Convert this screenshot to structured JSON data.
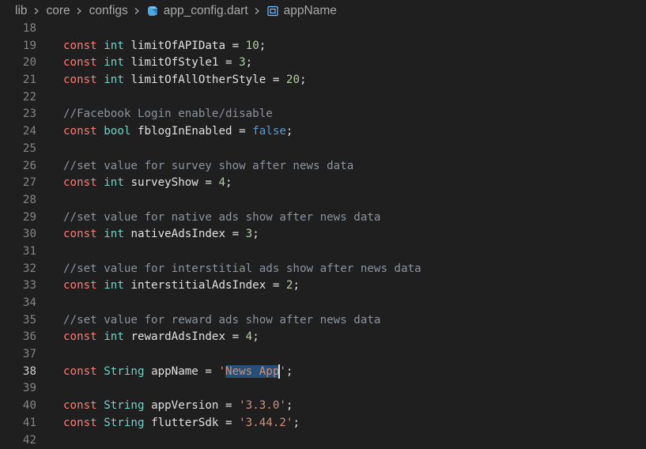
{
  "breadcrumb": {
    "items": [
      "lib",
      "core",
      "configs",
      "app_config.dart",
      "appName"
    ],
    "file_icon": "dart-file-icon",
    "symbol_icon": "field-symbol-icon"
  },
  "colors": {
    "background": "#1f1f1f",
    "keyword": "#ff7b72",
    "type": "#6fd3c8",
    "number": "#b5cea8",
    "boolean": "#569cd6",
    "string": "#ce9178",
    "comment": "#8b949e",
    "selection": "#264f78"
  },
  "editor": {
    "active_line": "38",
    "lines": [
      {
        "n": "18",
        "t": []
      },
      {
        "n": "19",
        "t": [
          [
            "kw",
            "const"
          ],
          [
            "sp",
            " "
          ],
          [
            "tp",
            "int"
          ],
          [
            "sp",
            " "
          ],
          [
            "id",
            "limitOfAPIData"
          ],
          [
            "id",
            " = "
          ],
          [
            "num",
            "10"
          ],
          [
            "id",
            ";"
          ]
        ]
      },
      {
        "n": "20",
        "t": [
          [
            "kw",
            "const"
          ],
          [
            "sp",
            " "
          ],
          [
            "tp",
            "int"
          ],
          [
            "sp",
            " "
          ],
          [
            "id",
            "limitOfStyle1"
          ],
          [
            "id",
            " = "
          ],
          [
            "num",
            "3"
          ],
          [
            "id",
            ";"
          ]
        ]
      },
      {
        "n": "21",
        "t": [
          [
            "kw",
            "const"
          ],
          [
            "sp",
            " "
          ],
          [
            "tp",
            "int"
          ],
          [
            "sp",
            " "
          ],
          [
            "id",
            "limitOfAllOtherStyle"
          ],
          [
            "id",
            " = "
          ],
          [
            "num",
            "20"
          ],
          [
            "id",
            ";"
          ]
        ]
      },
      {
        "n": "22",
        "t": []
      },
      {
        "n": "23",
        "t": [
          [
            "cm",
            "//Facebook Login enable/disable"
          ]
        ]
      },
      {
        "n": "24",
        "t": [
          [
            "kw",
            "const"
          ],
          [
            "sp",
            " "
          ],
          [
            "tp",
            "bool"
          ],
          [
            "sp",
            " "
          ],
          [
            "id",
            "fblogInEnabled"
          ],
          [
            "id",
            " = "
          ],
          [
            "bool",
            "false"
          ],
          [
            "id",
            ";"
          ]
        ]
      },
      {
        "n": "25",
        "t": []
      },
      {
        "n": "26",
        "t": [
          [
            "cm",
            "//set value for survey show after news data"
          ]
        ]
      },
      {
        "n": "27",
        "t": [
          [
            "kw",
            "const"
          ],
          [
            "sp",
            " "
          ],
          [
            "tp",
            "int"
          ],
          [
            "sp",
            " "
          ],
          [
            "id",
            "surveyShow"
          ],
          [
            "id",
            " = "
          ],
          [
            "num",
            "4"
          ],
          [
            "id",
            ";"
          ]
        ]
      },
      {
        "n": "28",
        "t": []
      },
      {
        "n": "29",
        "t": [
          [
            "cm",
            "//set value for native ads show after news data"
          ]
        ]
      },
      {
        "n": "30",
        "t": [
          [
            "kw",
            "const"
          ],
          [
            "sp",
            " "
          ],
          [
            "tp",
            "int"
          ],
          [
            "sp",
            " "
          ],
          [
            "id",
            "nativeAdsIndex"
          ],
          [
            "id",
            " = "
          ],
          [
            "num",
            "3"
          ],
          [
            "id",
            ";"
          ]
        ]
      },
      {
        "n": "31",
        "t": []
      },
      {
        "n": "32",
        "t": [
          [
            "cm",
            "//set value for interstitial ads show after news data"
          ]
        ]
      },
      {
        "n": "33",
        "t": [
          [
            "kw",
            "const"
          ],
          [
            "sp",
            " "
          ],
          [
            "tp",
            "int"
          ],
          [
            "sp",
            " "
          ],
          [
            "id",
            "interstitialAdsIndex"
          ],
          [
            "id",
            " = "
          ],
          [
            "num",
            "2"
          ],
          [
            "id",
            ";"
          ]
        ]
      },
      {
        "n": "34",
        "t": []
      },
      {
        "n": "35",
        "t": [
          [
            "cm",
            "//set value for reward ads show after news data"
          ]
        ]
      },
      {
        "n": "36",
        "t": [
          [
            "kw",
            "const"
          ],
          [
            "sp",
            " "
          ],
          [
            "tp",
            "int"
          ],
          [
            "sp",
            " "
          ],
          [
            "id",
            "rewardAdsIndex"
          ],
          [
            "id",
            " = "
          ],
          [
            "num",
            "4"
          ],
          [
            "id",
            ";"
          ]
        ]
      },
      {
        "n": "37",
        "t": []
      },
      {
        "n": "38",
        "t": [
          [
            "kw",
            "const"
          ],
          [
            "sp",
            " "
          ],
          [
            "tp",
            "String"
          ],
          [
            "sp",
            " "
          ],
          [
            "id",
            "appName"
          ],
          [
            "id",
            " = "
          ],
          [
            "str",
            "'"
          ],
          [
            "sel",
            "News App"
          ],
          [
            "cur",
            ""
          ],
          [
            "str",
            "'"
          ],
          [
            "id",
            ";"
          ]
        ]
      },
      {
        "n": "39",
        "t": []
      },
      {
        "n": "40",
        "t": [
          [
            "kw",
            "const"
          ],
          [
            "sp",
            " "
          ],
          [
            "tp",
            "String"
          ],
          [
            "sp",
            " "
          ],
          [
            "id",
            "appVersion"
          ],
          [
            "id",
            " = "
          ],
          [
            "str",
            "'3.3.0'"
          ],
          [
            "id",
            ";"
          ]
        ]
      },
      {
        "n": "41",
        "t": [
          [
            "kw",
            "const"
          ],
          [
            "sp",
            " "
          ],
          [
            "tp",
            "String"
          ],
          [
            "sp",
            " "
          ],
          [
            "id",
            "flutterSdk"
          ],
          [
            "id",
            " = "
          ],
          [
            "str",
            "'3.44.2'"
          ],
          [
            "id",
            ";"
          ]
        ]
      },
      {
        "n": "42",
        "t": []
      }
    ]
  }
}
